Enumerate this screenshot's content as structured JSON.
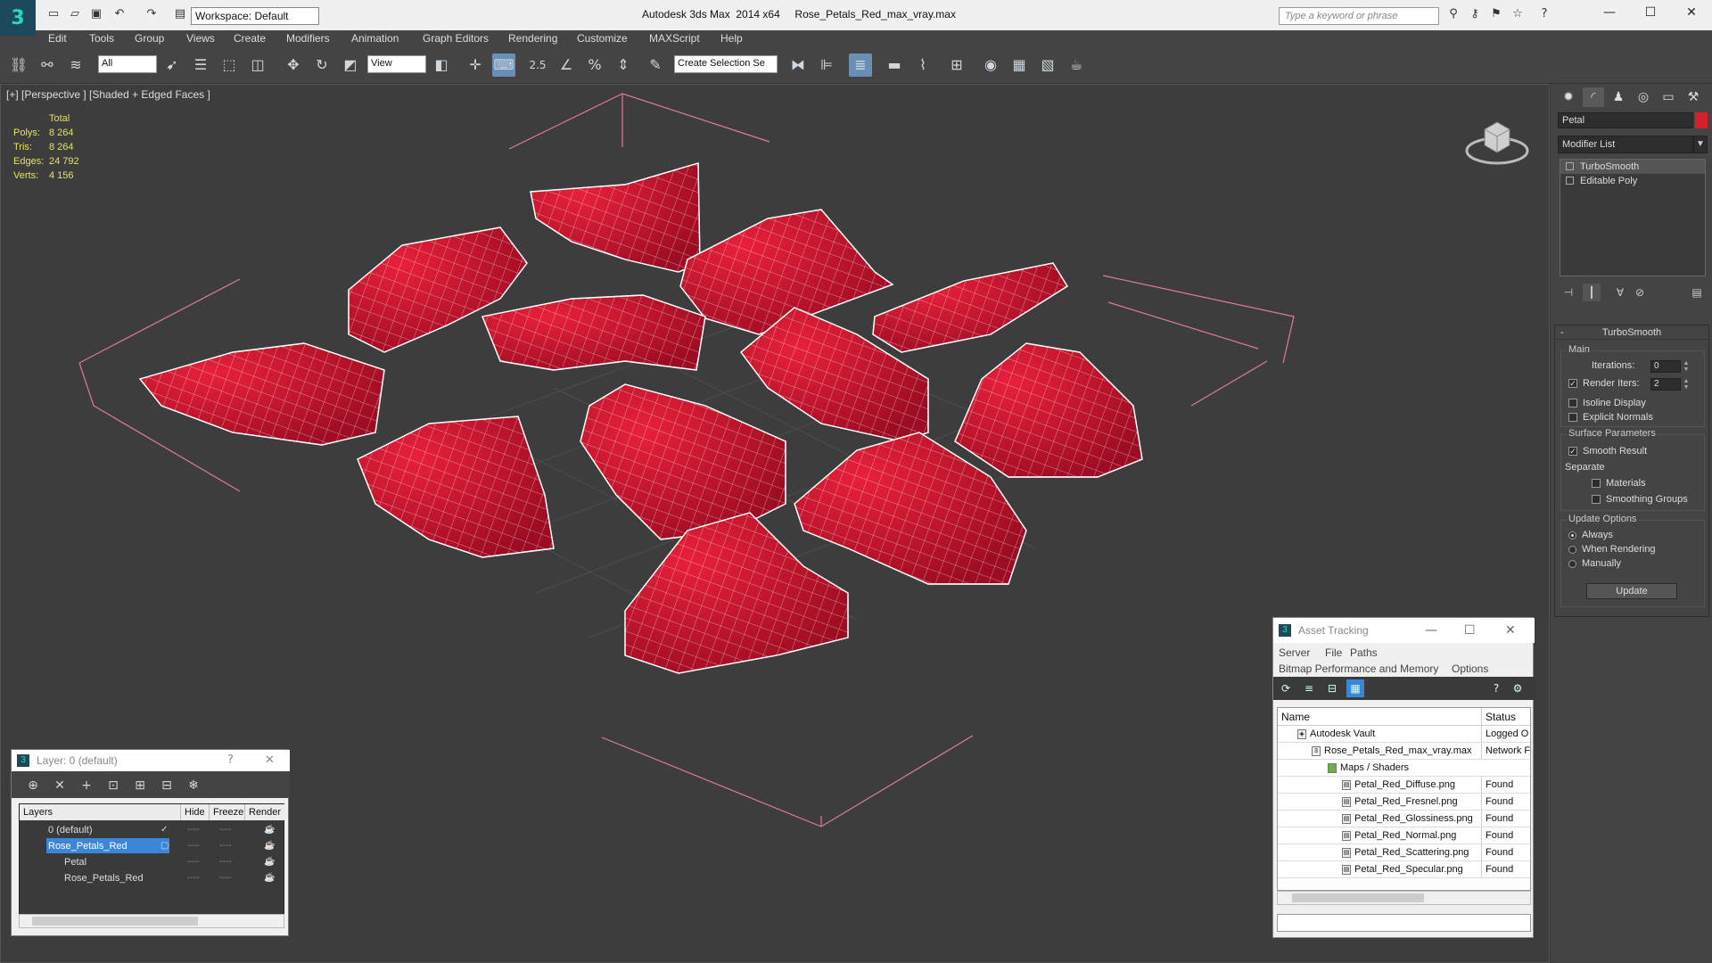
{
  "app": {
    "title": "Autodesk 3ds Max  2014 x64     Rose_Petals_Red_max_vray.max",
    "workspace": "Workspace: Default",
    "search_placeholder": "Type a keyword or phrase"
  },
  "menu": [
    "Edit",
    "Tools",
    "Group",
    "Views",
    "Create",
    "Modifiers",
    "Animation",
    "Graph Editors",
    "Rendering",
    "Customize",
    "MAXScript",
    "Help"
  ],
  "toolbar": {
    "filter_select": "All",
    "coord_select": "View",
    "snap_label": "2.5",
    "selection_set": "Create Selection Se"
  },
  "viewport": {
    "label": "[+] [Perspective ] [Shaded + Edged Faces ]",
    "stats": {
      "header": "Total",
      "rows": [
        {
          "k": "Polys:",
          "v": "8 264"
        },
        {
          "k": "Tris:",
          "v": "8 264"
        },
        {
          "k": "Edges:",
          "v": "24 792"
        },
        {
          "k": "Verts:",
          "v": "4 156"
        }
      ]
    },
    "colors": {
      "petal": "#c8102e",
      "petal_dark": "#8e0a1f",
      "wire": "#ffffff",
      "bbox": "#e07a9a",
      "grid": "#555555"
    }
  },
  "command_panel": {
    "object_name": "Petal",
    "object_color": "#d51f2a",
    "modifier_list": "Modifier List",
    "stack": [
      "TurboSmooth",
      "Editable Poly"
    ],
    "rollout": {
      "title": "TurboSmooth",
      "main_label": "Main",
      "iterations_label": "Iterations:",
      "iterations_value": "0",
      "render_iters_label": "Render Iters:",
      "render_iters_value": "2",
      "isoline": "Isoline Display",
      "explicit_normals": "Explicit Normals",
      "surface_label": "Surface Parameters",
      "smooth_result": "Smooth Result",
      "separate": "Separate",
      "materials": "Materials",
      "smoothing_groups": "Smoothing Groups",
      "update_options": "Update Options",
      "always": "Always",
      "when_rendering": "When Rendering",
      "manually": "Manually",
      "update_button": "Update"
    }
  },
  "layer_window": {
    "title": "Layer: 0 (default)",
    "columns": [
      "Layers",
      "Hide",
      "Freeze",
      "Render"
    ],
    "rows": [
      "0 (default)",
      "Rose_Petals_Red",
      "Petal",
      "Rose_Petals_Red"
    ]
  },
  "asset_window": {
    "title": "Asset Tracking",
    "menu1": [
      "Server",
      "File",
      "Paths"
    ],
    "menu2": [
      "Bitmap Performance and Memory",
      "Options"
    ],
    "columns": [
      "Name",
      "Status"
    ],
    "rows": [
      {
        "name": "Autodesk Vault",
        "status": "Logged O"
      },
      {
        "name": "Rose_Petals_Red_max_vray.max",
        "status": "Network F"
      },
      {
        "name": "Maps / Shaders",
        "status": ""
      },
      {
        "name": "Petal_Red_Diffuse.png",
        "status": "Found"
      },
      {
        "name": "Petal_Red_Fresnel.png",
        "status": "Found"
      },
      {
        "name": "Petal_Red_Glossiness.png",
        "status": "Found"
      },
      {
        "name": "Petal_Red_Normal.png",
        "status": "Found"
      },
      {
        "name": "Petal_Red_Scattering.png",
        "status": "Found"
      },
      {
        "name": "Petal_Red_Specular.png",
        "status": "Found"
      }
    ]
  }
}
